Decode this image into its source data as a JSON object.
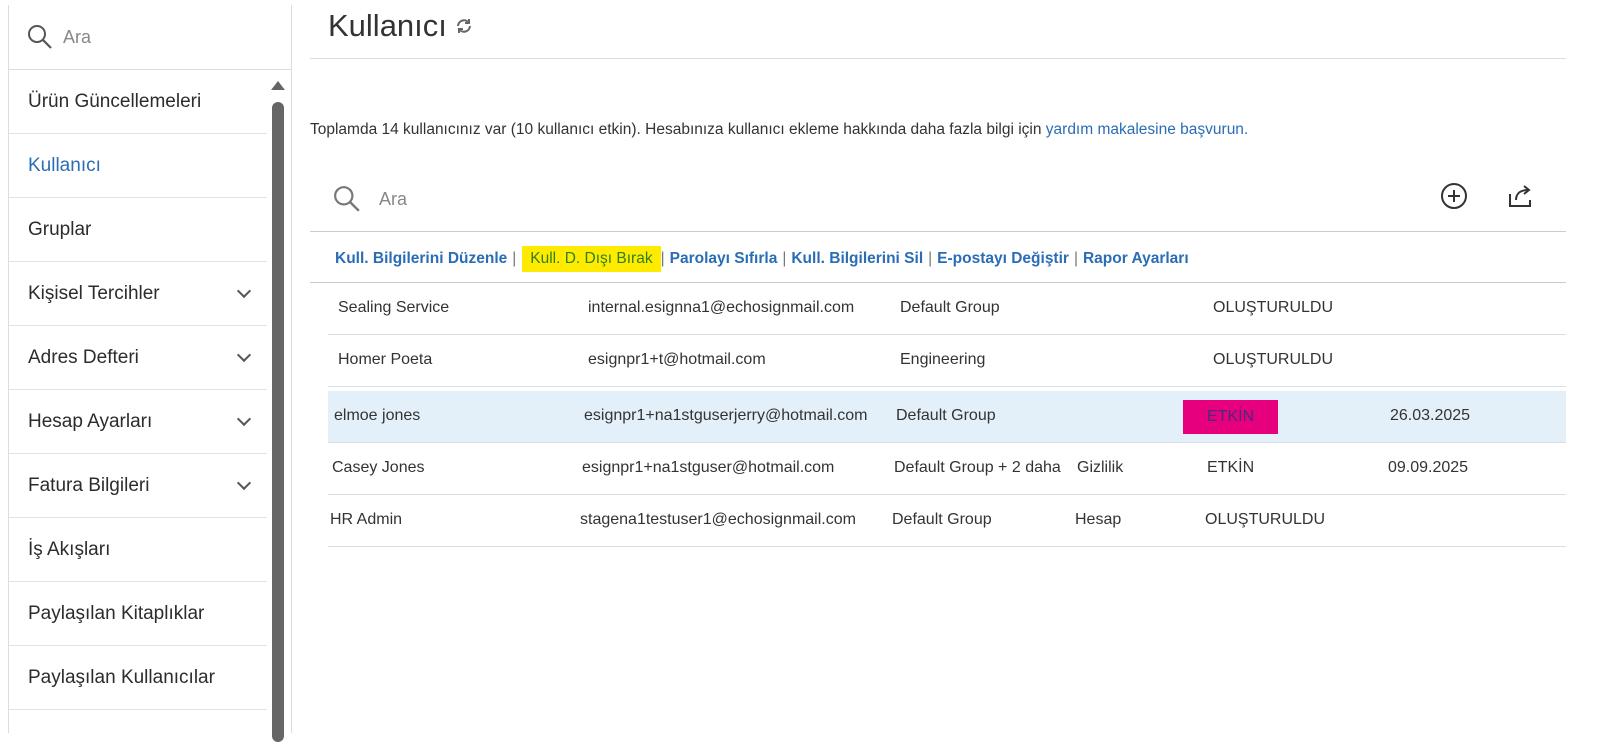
{
  "sidebar": {
    "search_placeholder": "Ara",
    "items": [
      {
        "label": "Ürün Güncellemeleri",
        "chevron": false
      },
      {
        "label": "Kullanıcı",
        "chevron": false,
        "active": true
      },
      {
        "label": "Gruplar",
        "chevron": false
      },
      {
        "label": "Kişisel Tercihler",
        "chevron": true
      },
      {
        "label": "Adres Defteri",
        "chevron": true
      },
      {
        "label": "Hesap Ayarları",
        "chevron": true
      },
      {
        "label": "Fatura Bilgileri",
        "chevron": true
      },
      {
        "label": "İş Akışları",
        "chevron": false
      },
      {
        "label": "Paylaşılan Kitaplıklar",
        "chevron": false
      },
      {
        "label": "Paylaşılan Kullanıcılar",
        "chevron": false
      }
    ]
  },
  "header": {
    "title": "Kullanıcı"
  },
  "info": {
    "text": "Toplamda 14 kullanıcınız var (10 kullanıcı etkin). Hesabınıza kullanıcı ekleme hakkında daha fazla bilgi için ",
    "link": "yardım makalesine başvurun."
  },
  "search": {
    "placeholder": "Ara"
  },
  "actions": [
    "Kull. Bilgilerini Düzenle",
    "Kull. D. Dışı Bırak",
    "Parolayı Sıfırla",
    "Kull. Bilgilerini Sil",
    "E-postayı Değiştir",
    "Rapor Ayarları"
  ],
  "rows": [
    {
      "name": "Sealing Service",
      "email": "internal.esignna1@echosignmail.com",
      "group": "Default Group",
      "extra": "",
      "status": "OLUŞTURULDU",
      "date": ""
    },
    {
      "name": "Homer Poeta",
      "email": "esignpr1+t@hotmail.com",
      "group": "Engineering",
      "extra": "",
      "status": "OLUŞTURULDU",
      "date": ""
    },
    {
      "name": "elmoe jones",
      "email": "esignpr1+na1stguserjerry@hotmail.com",
      "group": "Default Group",
      "extra": "",
      "status": "ETKİN",
      "date": "26.03.2025",
      "selected": true
    },
    {
      "name": "Casey Jones",
      "email": "esignpr1+na1stguser@hotmail.com",
      "group": "Default Group + 2 daha",
      "extra": "Gizlilik",
      "status": "ETKİN",
      "date": "09.09.2025"
    },
    {
      "name": "HR Admin",
      "email": "stagena1testuser1@echosignmail.com",
      "group": "Default Group",
      "extra": "Hesap",
      "status": "OLUŞTURULDU",
      "date": ""
    }
  ],
  "colors": {
    "accent": "#2a6db5",
    "highlight": "#ffeb00",
    "badge": "#e6007e",
    "selected_row": "#e3f0fa"
  }
}
